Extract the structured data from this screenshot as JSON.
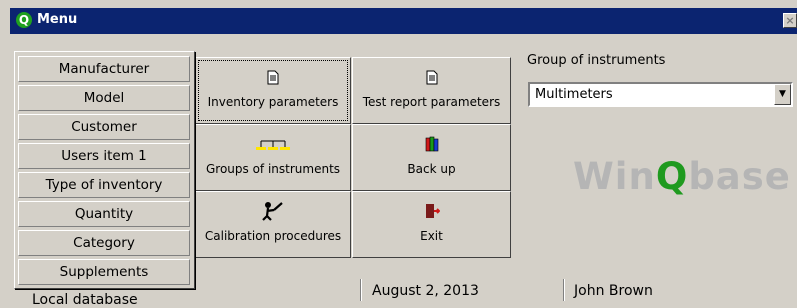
{
  "window": {
    "title": "Menu",
    "close_label": "×"
  },
  "popup_menu": {
    "items": [
      {
        "label": "Manufacturer"
      },
      {
        "label": "Model"
      },
      {
        "label": "Customer"
      },
      {
        "label": "Users item 1"
      },
      {
        "label": "Type of inventory"
      },
      {
        "label": "Quantity"
      },
      {
        "label": "Category"
      },
      {
        "label": "Supplements"
      }
    ]
  },
  "buttons": {
    "inventory_parameters": {
      "label": "Inventory parameters",
      "icon": "document-icon"
    },
    "test_report_parameters": {
      "label": "Test report parameters",
      "icon": "document-icon"
    },
    "groups_of_instruments": {
      "label": "Groups of instruments",
      "icon": "groups-icon"
    },
    "back_up": {
      "label": "Back up",
      "icon": "books-icon"
    },
    "calibration_procedures": {
      "label": "Calibration procedures",
      "icon": "calibration-icon"
    },
    "exit": {
      "label": "Exit",
      "icon": "exit-door-icon"
    }
  },
  "group_selector": {
    "label": "Group of instruments",
    "selected": "Multimeters"
  },
  "brand": {
    "logo_text_prefix": "Win",
    "logo_text_q": "Q",
    "logo_text_suffix": "base"
  },
  "status_bar": {
    "database": "Local database",
    "date": "August 2, 2013",
    "user": "John Brown"
  },
  "colors": {
    "title_bar": "#0b2470",
    "logo_green": "#1f9a1f",
    "face": "#d4d0c8"
  }
}
